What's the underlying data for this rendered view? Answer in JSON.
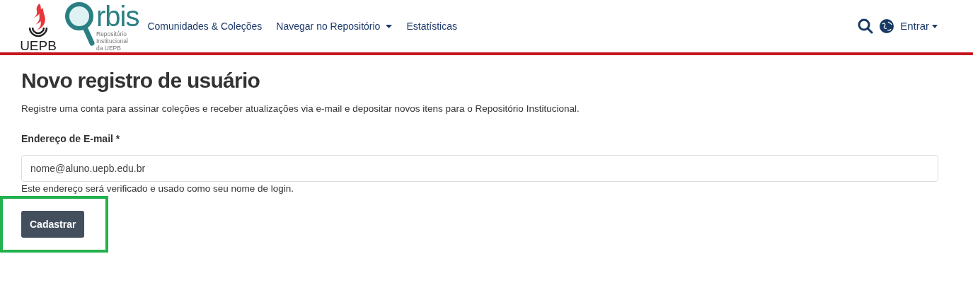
{
  "header": {
    "logo_text": "UEPB",
    "brand_text": "rbis",
    "brand_subtitle": [
      "Repositório",
      "Institucional",
      "da UEPB"
    ],
    "nav": [
      {
        "label": "Comunidades & Coleções",
        "dropdown": false
      },
      {
        "label": "Navegar no Repositório",
        "dropdown": true
      },
      {
        "label": "Estatísticas",
        "dropdown": false
      }
    ],
    "login": "Entrar"
  },
  "page": {
    "title": "Novo registro de usuário",
    "intro": "Registre uma conta para assinar coleções e receber atualizações via e-mail e depositar novos itens para o Repositório Institucional.",
    "field": {
      "label": "Endereço de E-mail *",
      "value": "nome@aluno.uepb.edu.br",
      "help": "Este endereço será verificado e usado como seu nome de login."
    },
    "submit": "Cadastrar",
    "submit_highlighted": true
  }
}
